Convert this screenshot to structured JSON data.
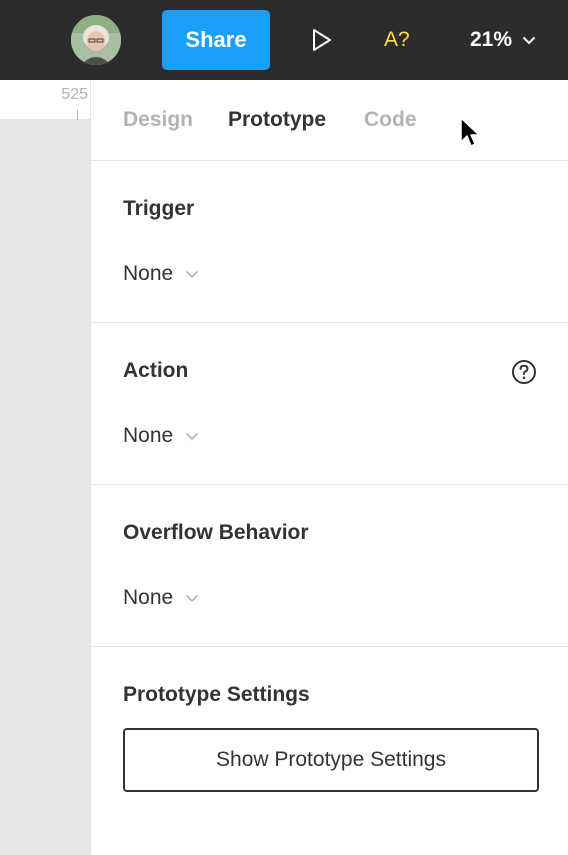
{
  "toolbar": {
    "share_label": "Share",
    "a11y_label": "A?",
    "zoom_label": "21%",
    "colors": {
      "background": "#2c2c2c",
      "share": "#18a0fb",
      "a11y": "#ffe03d"
    }
  },
  "ruler": {
    "label": "525"
  },
  "tabs": [
    {
      "label": "Design",
      "active": false
    },
    {
      "label": "Prototype",
      "active": true
    },
    {
      "label": "Code",
      "active": false
    }
  ],
  "sections": {
    "trigger": {
      "title": "Trigger",
      "value": "None"
    },
    "action": {
      "title": "Action",
      "value": "None"
    },
    "overflow": {
      "title": "Overflow Behavior",
      "value": "None"
    },
    "settings": {
      "title": "Prototype Settings",
      "button_label": "Show Prototype Settings"
    }
  },
  "icons": {
    "avatar": "user-avatar",
    "play": "play-icon",
    "zoom": "chevron-down-icon",
    "dropdown": "chevron-down-icon",
    "help": "help-circle-icon",
    "cursor": "mouse-pointer-icon"
  }
}
